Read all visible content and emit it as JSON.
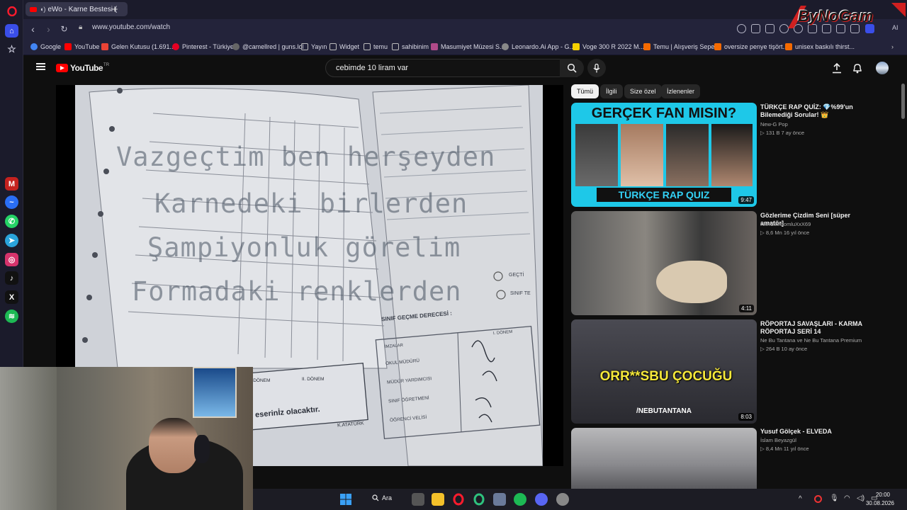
{
  "browser": {
    "tab_title": "eWo - Karne Bestesi (",
    "url": "www.youtube.com/watch",
    "bookmarks": [
      "Google",
      "YouTube",
      "Gelen Kutusu (1.691...",
      "Pinterest - Türkiye",
      "@camellred | guns.lol",
      "Yayın",
      "Widget",
      "temu",
      "sahibinim",
      "Masumiyet Müzesi S...",
      "Leonardo.Ai App - G...",
      "Voge 300 R 2022 M...",
      "Temu | Alışveriş Sepeti",
      "oversize penye tişört...",
      "unisex baskılı thirst..."
    ],
    "ai_label": "AI"
  },
  "youtube": {
    "logo_text": "YouTube",
    "logo_sup": "TR",
    "search_query": "cebimde 10 liram var",
    "chips": [
      "Tümü",
      "İlgili",
      "Size özel",
      "İzlenenler"
    ],
    "video": {
      "lyrics": [
        "Vazgeçtim ben herşeyden",
        "Karnedeki birlerden",
        "Şampiyonluk görelim",
        "Formadaki renklerden"
      ],
      "report_card_text": "eserinİz olacaktır.",
      "report_card_footer": "K.ATATÜRK",
      "section_heading": "SINIF GEÇME DERECESİ :",
      "option_1": "GEÇTİ",
      "option_2": "SINIF TE",
      "signatures": [
        "OKUL MÜDÜRÜ",
        "MÜDÜR YARDIMCISI",
        "SINIF ÖĞRETMENİ",
        "ÖĞRENCİ VELİSİ"
      ],
      "column_1": "I. DÖNEM",
      "column_2": "II. DÖNEM",
      "column_3": "II. DÖNEM",
      "imzalar": "İMZALAR"
    },
    "recommendations": [
      {
        "thumb_text_top": "GERÇEK FAN MISIN?",
        "thumb_text_bottom": "TÜRKÇE RAP QUIZ",
        "duration": "9:47",
        "title": "TÜRKÇE RAP QUİZ: 💎%99'un Bilemediği Sorular! 👑",
        "channel": "New-G Pop",
        "meta": "▷ 131 B   7 ay önce"
      },
      {
        "duration": "4:11",
        "title": "Gözlerime Çizdim Seni [süper amatör]",
        "channel": "XxXCiimbomluXxX69",
        "meta": "▷ 8,6 Mn   16 yıl önce"
      },
      {
        "thumb_text": "ORR**SBU ÇOCUĞU",
        "thumb_sub": "/NEBUTANTANA",
        "duration": "8:03",
        "title": "RÖPORTAJ SAVAŞLARI - KARMA RÖPORTAJ SERİ 14",
        "channel": "Ne Bu Tantana ve Ne Bu Tantana Premium",
        "meta": "▷ 264 B   10 ay önce"
      },
      {
        "title": "Yusuf Gölçek - ELVEDA",
        "channel": "İslam Beyazgül",
        "meta": "▷ 8,4 Mn   11 yıl önce"
      }
    ]
  },
  "taskbar": {
    "search_label": "Ara",
    "time": "20:00",
    "date": "30.08.2026"
  },
  "watermark": "ByNoGam"
}
